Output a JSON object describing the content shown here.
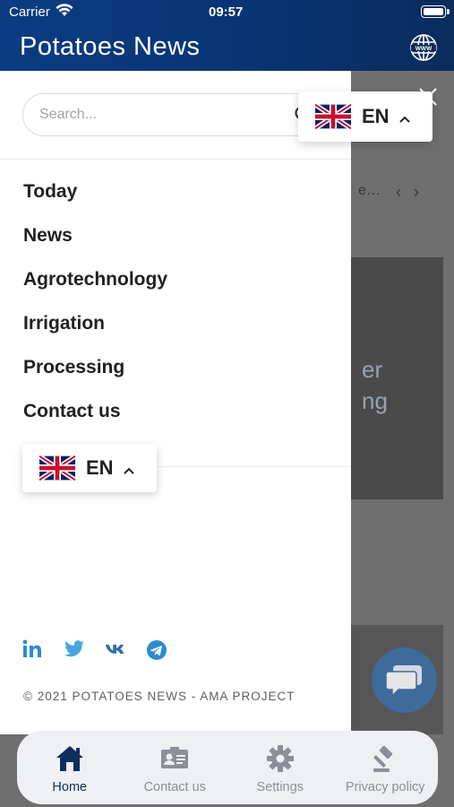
{
  "status_bar": {
    "carrier": "Carrier",
    "time": "09:57"
  },
  "header": {
    "title": "Potatoes News"
  },
  "drawer": {
    "search": {
      "placeholder": "Search..."
    },
    "menu": [
      {
        "label": "Today"
      },
      {
        "label": "News"
      },
      {
        "label": "Agrotechnology"
      },
      {
        "label": "Irrigation"
      },
      {
        "label": "Processing"
      },
      {
        "label": "Contact us"
      }
    ],
    "language": {
      "code": "EN"
    },
    "socials": [
      "linkedin-icon",
      "twitter-icon",
      "vk-icon",
      "telegram-icon"
    ],
    "copyright": "© 2021 POTATOES NEWS - AMA PROJECT"
  },
  "language_dropdown": {
    "code": "EN"
  },
  "background": {
    "line1": "er",
    "line2": "ng"
  },
  "tabbar": {
    "tabs": [
      {
        "label": "Home",
        "icon": "home-icon",
        "active": true
      },
      {
        "label": "Contact us",
        "icon": "contact-card-icon",
        "active": false
      },
      {
        "label": "Settings",
        "icon": "gear-icon",
        "active": false
      },
      {
        "label": "Privacy policy",
        "icon": "gavel-icon",
        "active": false
      }
    ]
  },
  "colors": {
    "header": "#0b3c82",
    "active_tab": "#0f2d5c",
    "social": "#2a8bd0",
    "overlay": "#6f6f6f"
  }
}
